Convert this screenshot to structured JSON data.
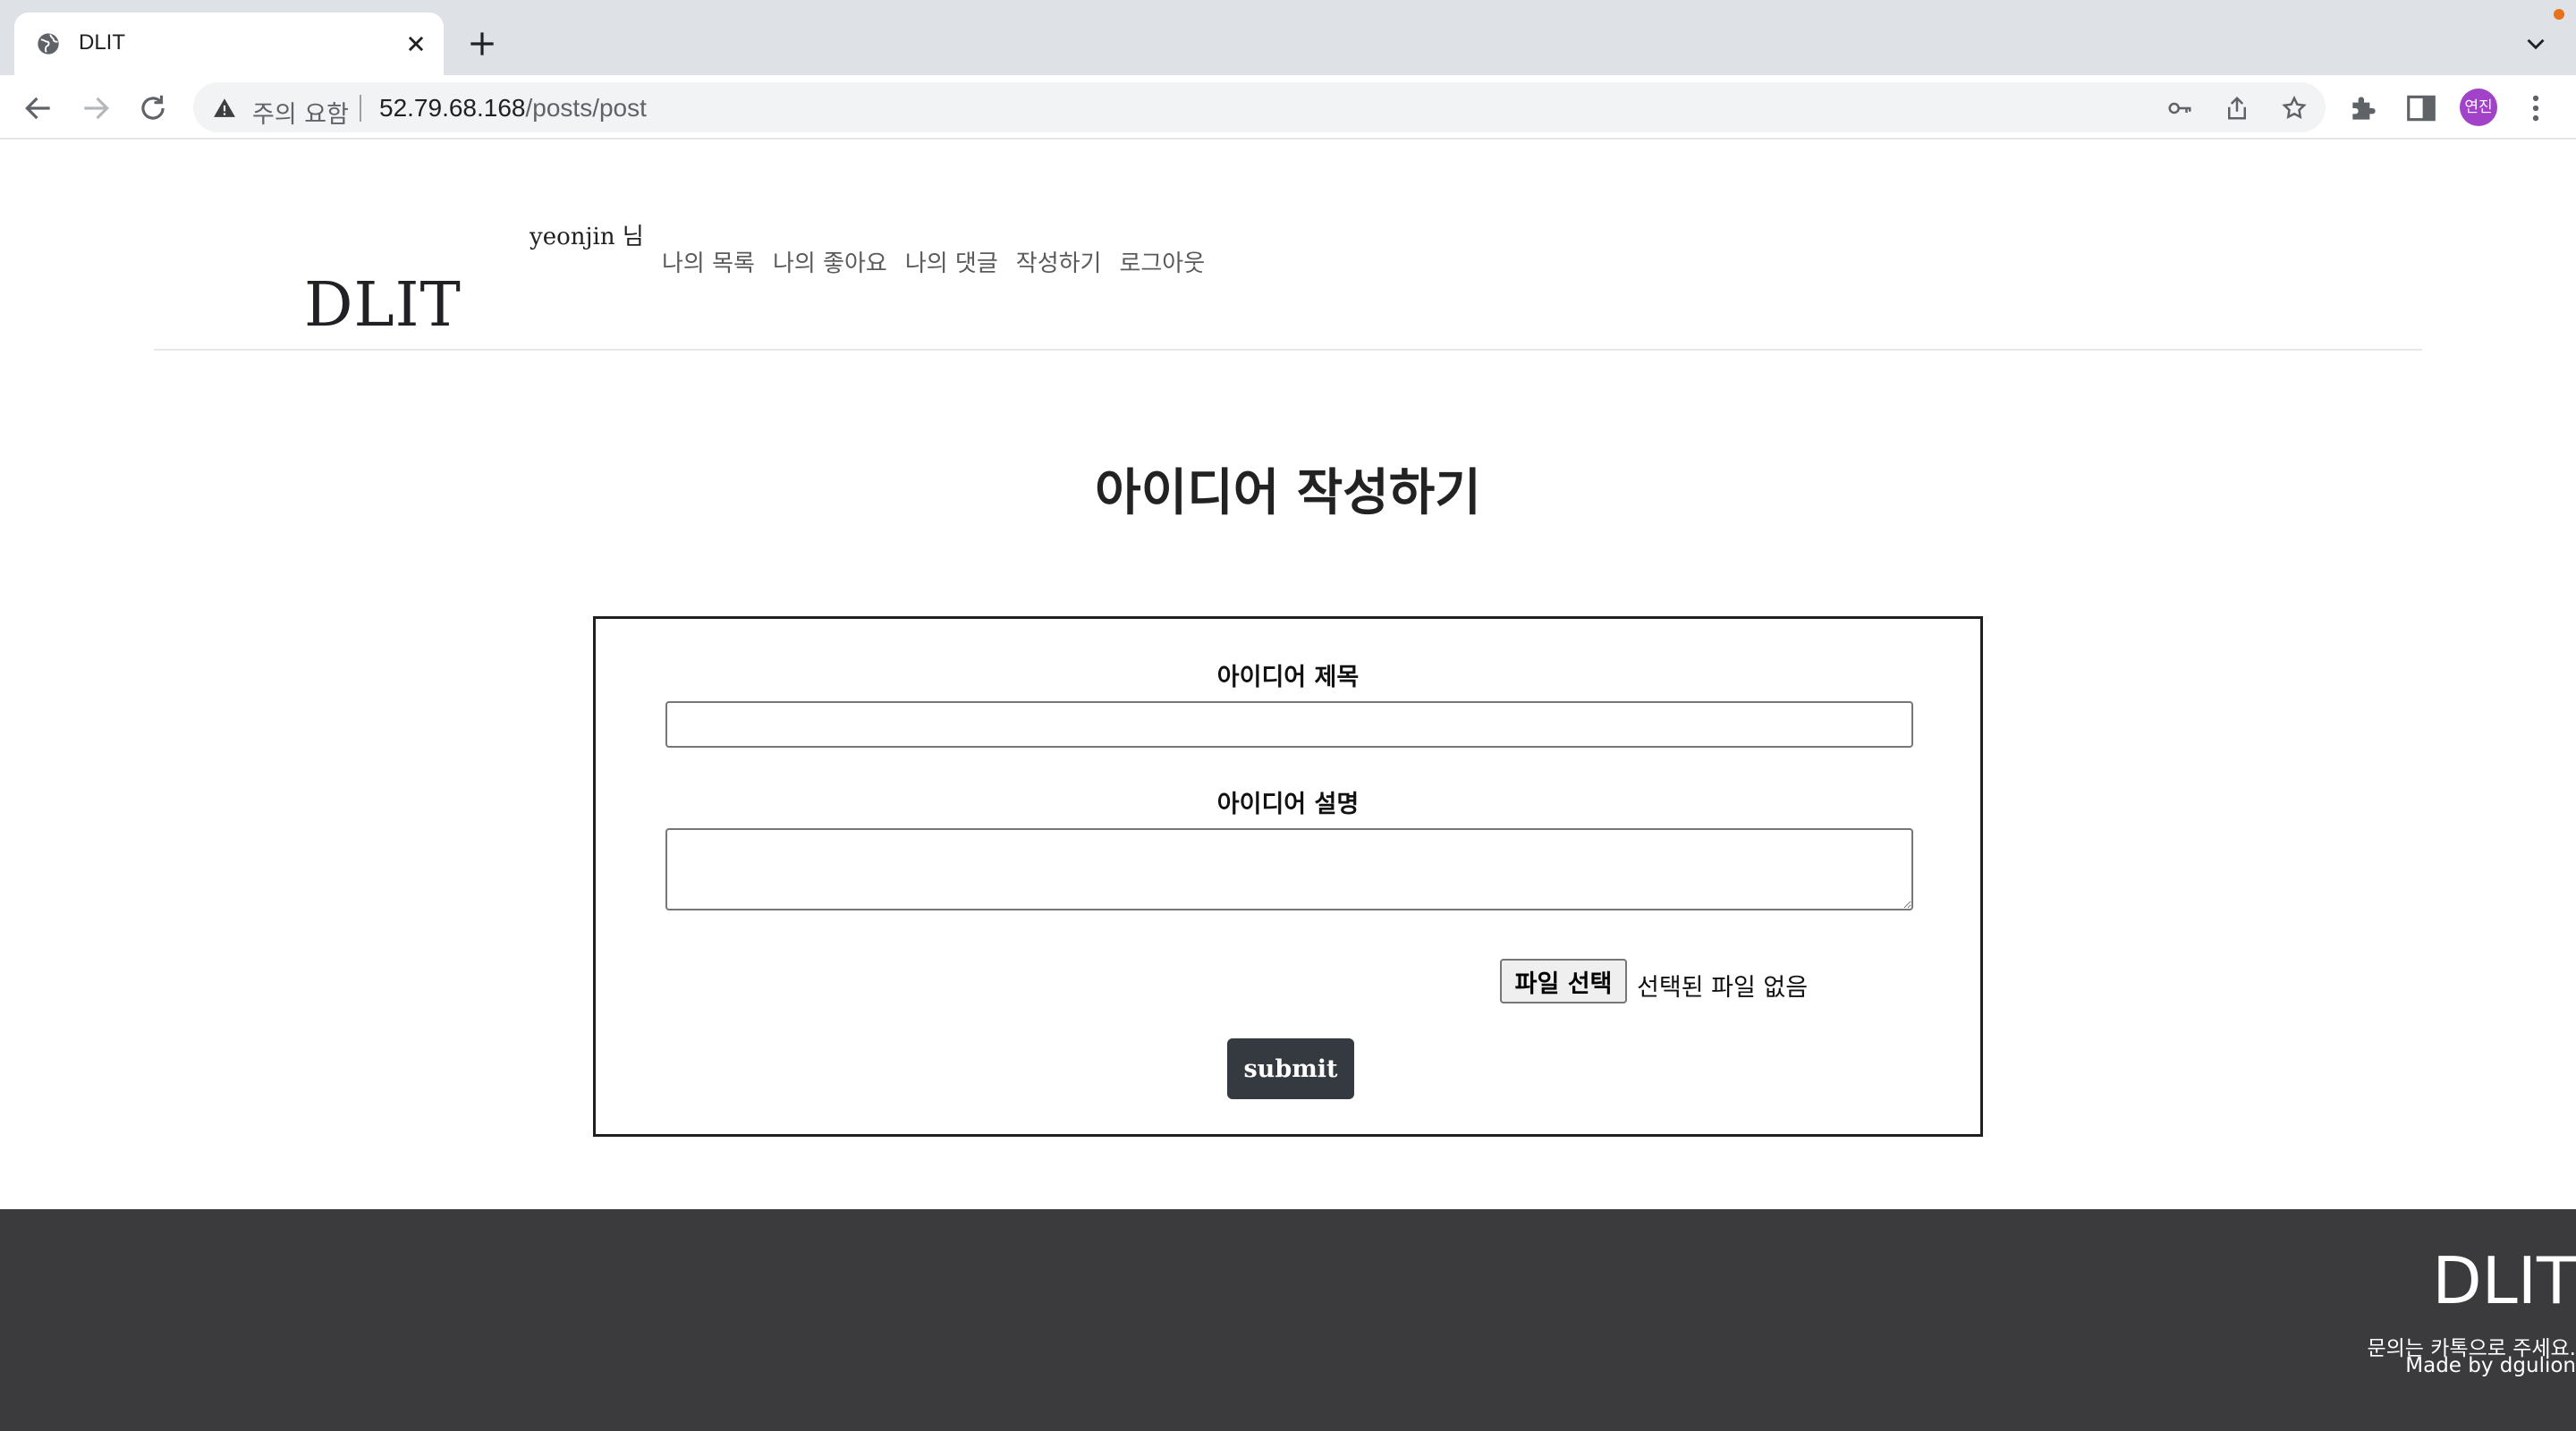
{
  "browser": {
    "tab_title": "DLIT",
    "security_warning": "주의 요함",
    "url_host": "52.79.68.168",
    "url_path": "/posts/post",
    "profile_initials": "연진"
  },
  "header": {
    "logo": "DLIT",
    "username": "yeonjin 님",
    "nav": [
      "나의 목록",
      "나의 좋아요",
      "나의 댓글",
      "작성하기",
      "로그아웃"
    ]
  },
  "main": {
    "title": "아이디어 작성하기",
    "form": {
      "title_label": "아이디어 제목",
      "title_value": "",
      "description_label": "아이디어 설명",
      "description_value": "",
      "file_button_label": "파일 선택",
      "file_status": "선택된 파일 없음",
      "submit_label": "submit"
    }
  },
  "footer": {
    "logo": "DLIT",
    "contact": "문의는 카톡으로 주세요.",
    "credit": "Made by dgulion"
  }
}
